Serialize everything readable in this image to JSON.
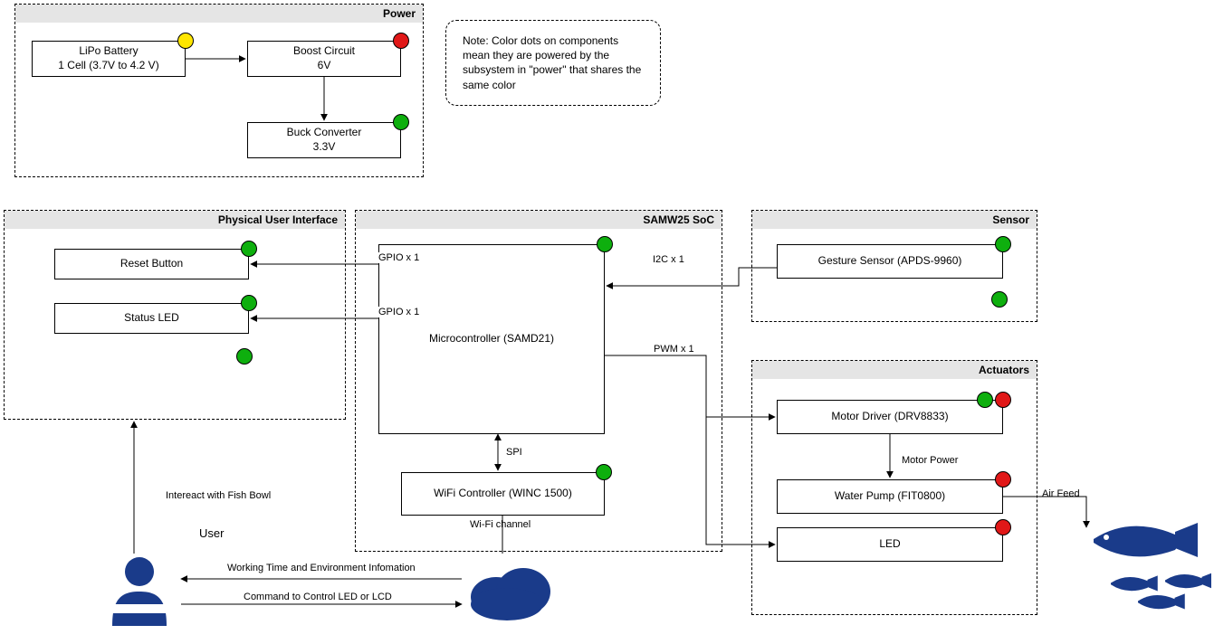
{
  "groups": {
    "power": {
      "title": "Power"
    },
    "pui": {
      "title": "Physical User Interface"
    },
    "soc": {
      "title": "SAMW25 SoC"
    },
    "sensor": {
      "title": "Sensor"
    },
    "act": {
      "title": "Actuators"
    }
  },
  "note": "Note: Color dots on components mean they are powered by the subsystem in \"power\" that shares the same color",
  "blocks": {
    "lipo": {
      "l1": "LiPo Battery",
      "l2": "1 Cell (3.7V to 4.2 V)"
    },
    "boost": {
      "l1": "Boost Circuit",
      "l2": "6V"
    },
    "buck": {
      "l1": "Buck Converter",
      "l2": "3.3V"
    },
    "reset": {
      "l1": "Reset Button"
    },
    "led": {
      "l1": "Status LED"
    },
    "mcu": {
      "l1": "Microcontroller (SAMD21)"
    },
    "wifi": {
      "l1": "WiFi Controller (WINC 1500)"
    },
    "gest": {
      "l1": "Gesture Sensor (APDS-9960)"
    },
    "motor": {
      "l1": "Motor Driver (DRV8833)"
    },
    "pump": {
      "l1": "Water Pump (FIT0800)"
    },
    "led2": {
      "l1": "LED"
    }
  },
  "edges": {
    "gpio1": "GPIO x 1",
    "gpio2": "GPIO x 1",
    "i2c": "I2C x 1",
    "pwm": "PWM x 1",
    "spi": "SPI",
    "wifich": "Wi-Fi channel",
    "mpow": "Motor Power",
    "airfeed": "Air Feed",
    "inter": "Intereact with Fish Bowl",
    "wtime": "Working Time and Environment Infomation",
    "cmd": "Command to Control LED or LCD",
    "user": "User"
  },
  "colors": {
    "green": "#0eaf0e",
    "red": "#e11818",
    "yellow": "#ffe600",
    "navy": "#1a3b8a"
  }
}
